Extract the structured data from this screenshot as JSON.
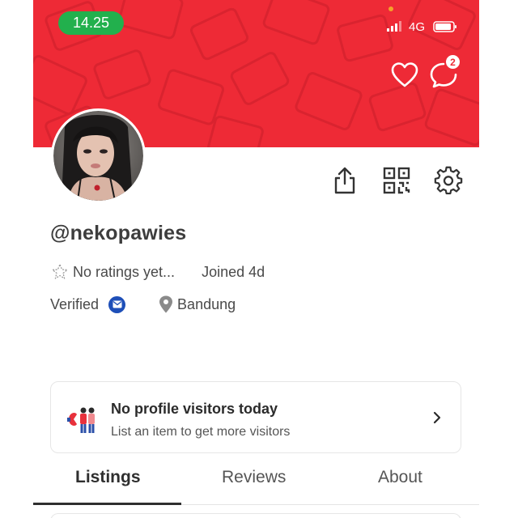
{
  "status_bar": {
    "time": "14.25",
    "network": "4G",
    "icons": [
      "signal-icon",
      "battery-icon"
    ]
  },
  "header": {
    "actions": [
      "heart-icon",
      "chat-icon"
    ],
    "chat_badge_count": "2",
    "background_color": "#ee2a36"
  },
  "profile": {
    "username": "@nekopawies",
    "rating_text": "No ratings yet...",
    "joined_text": "Joined 4d",
    "verified_label": "Verified",
    "location": "Bandung",
    "actions": [
      "share-icon",
      "qr-code-icon",
      "gear-icon"
    ]
  },
  "visitors_card": {
    "title": "No profile visitors today",
    "subtitle": "List an item to get more visitors"
  },
  "tabs": [
    {
      "label": "Listings",
      "active": true
    },
    {
      "label": "Reviews",
      "active": false
    },
    {
      "label": "About",
      "active": false
    }
  ],
  "colors": {
    "accent": "#ee2a36",
    "status_time_bg": "#22b04d",
    "verified_badge": "#1e4fb8"
  }
}
